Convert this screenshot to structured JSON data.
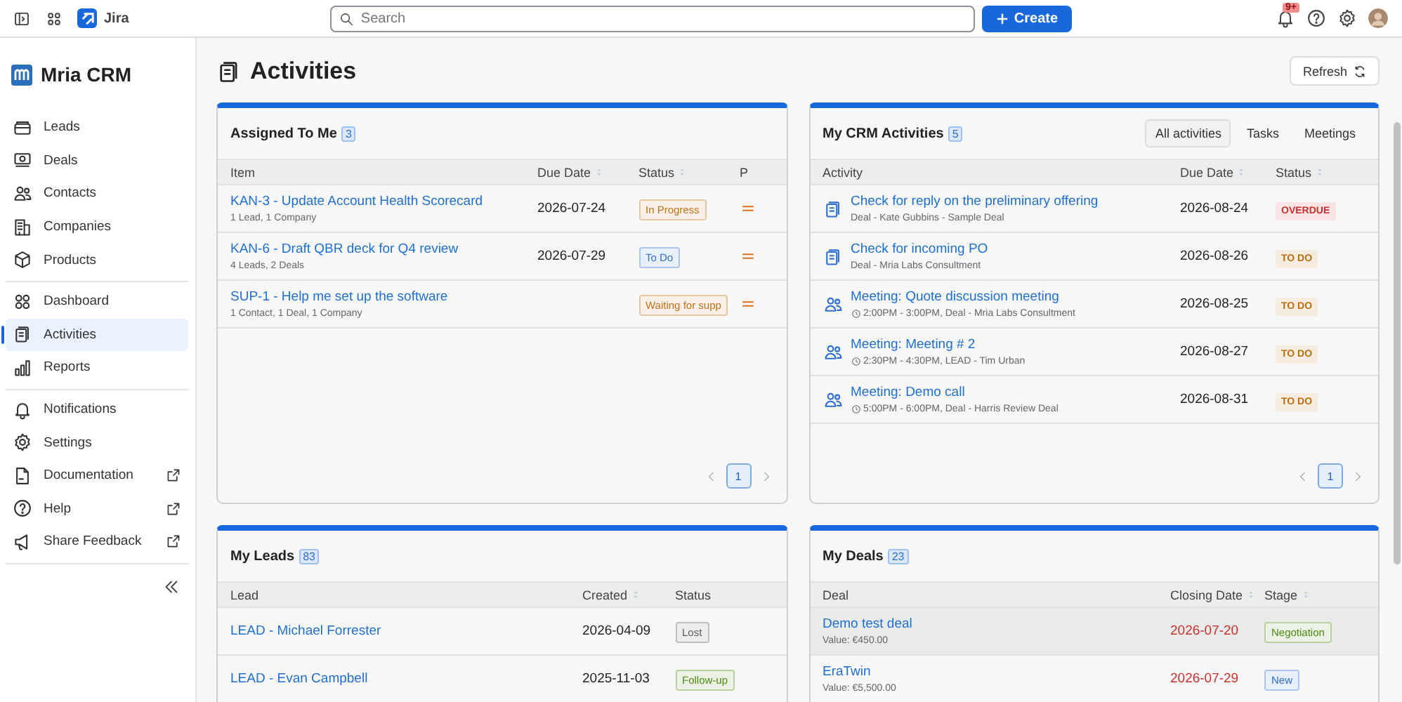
{
  "topbar": {
    "product": "Jira",
    "search": {
      "placeholder": "Search"
    },
    "create_button": "Create",
    "notification_badge": "9+"
  },
  "sidebar": {
    "app_name": "Mria CRM",
    "groups": [
      [
        {
          "label": "Leads",
          "selected": false,
          "external": false
        },
        {
          "label": "Deals",
          "selected": false,
          "external": false
        },
        {
          "label": "Contacts",
          "selected": false,
          "external": false
        },
        {
          "label": "Companies",
          "selected": false,
          "external": false
        },
        {
          "label": "Products",
          "selected": false,
          "external": false
        }
      ],
      [
        {
          "label": "Dashboard",
          "selected": false,
          "external": false
        },
        {
          "label": "Activities",
          "selected": true,
          "external": false
        },
        {
          "label": "Reports",
          "selected": false,
          "external": false
        }
      ],
      [
        {
          "label": "Notifications",
          "selected": false,
          "external": false
        },
        {
          "label": "Settings",
          "selected": false,
          "external": false
        },
        {
          "label": "Documentation",
          "selected": false,
          "external": true
        },
        {
          "label": "Help",
          "selected": false,
          "external": true
        },
        {
          "label": "Share Feedback",
          "selected": false,
          "external": true
        }
      ]
    ]
  },
  "page": {
    "title": "Activities",
    "refresh_button": "Refresh"
  },
  "assigned": {
    "title": "Assigned To Me",
    "count": "3",
    "columns": [
      {
        "label": "Item",
        "sortable": false
      },
      {
        "label": "Due Date",
        "sortable": true
      },
      {
        "label": "Status",
        "sortable": true
      },
      {
        "label": "P",
        "sortable": false
      }
    ],
    "rows": [
      {
        "title": "KAN-3 - Update Account Health Scorecard",
        "subtitle": "1 Lead, 1 Company",
        "due": "2026-07-24",
        "status": {
          "label": "In Progress",
          "color": "#c0731a"
        }
      },
      {
        "title": "KAN-6 - Draft QBR deck for Q4 review",
        "subtitle": "4 Leads, 2 Deals",
        "due": "2026-07-29",
        "status": {
          "label": "To Do",
          "color": "#2f6fd1"
        }
      },
      {
        "title": "SUP-1 - Help me set up the software",
        "subtitle": "1 Contact, 1 Deal, 1 Company",
        "due": "",
        "status": {
          "label": "Waiting for supp",
          "color": "#c0731a"
        }
      }
    ],
    "pages": [
      {
        "label": "1",
        "selected": true
      }
    ]
  },
  "crm_activities": {
    "title": "My CRM Activities",
    "count": "5",
    "tabs": [
      {
        "label": "All activities",
        "selected": true
      },
      {
        "label": "Tasks",
        "selected": false
      },
      {
        "label": "Meetings",
        "selected": false
      }
    ],
    "columns": [
      {
        "label": "Activity",
        "sortable": false
      },
      {
        "label": "Due Date",
        "sortable": true
      },
      {
        "label": "Status",
        "sortable": true
      }
    ],
    "rows": [
      {
        "kind": "task",
        "title": "Check for reply on the preliminary offering",
        "subtitle": "Deal - Kate Gubbins - Sample Deal",
        "due": "2026-08-24",
        "status": {
          "label": "OVERDUE",
          "color": "#c8302c"
        }
      },
      {
        "kind": "task",
        "title": "Check for incoming PO",
        "subtitle": "Deal - Mria Labs Consultment",
        "due": "2026-08-26",
        "status": {
          "label": "TO DO",
          "color": "#b86e10"
        }
      },
      {
        "kind": "meeting",
        "title": "Meeting: Quote discussion meeting",
        "subtitle": "2:00PM - 3:00PM, Deal - Mria Labs Consultment",
        "due": "2026-08-25",
        "status": {
          "label": "TO DO",
          "color": "#b86e10"
        }
      },
      {
        "kind": "meeting",
        "title": "Meeting: Meeting # 2",
        "subtitle": "2:30PM - 4:30PM, LEAD - Tim Urban",
        "due": "2026-08-27",
        "status": {
          "label": "TO DO",
          "color": "#b86e10"
        }
      },
      {
        "kind": "meeting",
        "title": "Meeting: Demo call",
        "subtitle": "5:00PM - 6:00PM, Deal - Harris Review Deal",
        "due": "2026-08-31",
        "status": {
          "label": "TO DO",
          "color": "#b86e10"
        }
      }
    ],
    "pages": [
      {
        "label": "1",
        "selected": true
      }
    ]
  },
  "leads": {
    "title": "My Leads",
    "count": "83",
    "columns": [
      {
        "label": "Lead",
        "sortable": false
      },
      {
        "label": "Created",
        "sortable": true
      },
      {
        "label": "Status",
        "sortable": false
      }
    ],
    "rows": [
      {
        "title": "LEAD - Michael Forrester",
        "created": "2026-04-09",
        "status": {
          "label": "Lost",
          "color": "#5c5c5c"
        }
      },
      {
        "title": "LEAD - Evan Campbell",
        "created": "2025-11-03",
        "status": {
          "label": "Follow-up",
          "color": "#4f8a10"
        }
      }
    ]
  },
  "deals": {
    "title": "My Deals",
    "count": "23",
    "columns": [
      {
        "label": "Deal",
        "sortable": false
      },
      {
        "label": "Closing Date",
        "sortable": true
      },
      {
        "label": "Stage",
        "sortable": true
      }
    ],
    "rows": [
      {
        "title": "Demo test deal",
        "subtitle": "Value: €450.00",
        "closing": "2026-07-20",
        "overdue": true,
        "selected": true,
        "stage": {
          "label": "Negotiation",
          "color": "#4f8a10"
        }
      },
      {
        "title": "EraTwin",
        "subtitle": "Value: €5,500.00",
        "closing": "2026-07-29",
        "overdue": true,
        "selected": false,
        "stage": {
          "label": "New",
          "color": "#2f6fd1"
        }
      }
    ]
  }
}
